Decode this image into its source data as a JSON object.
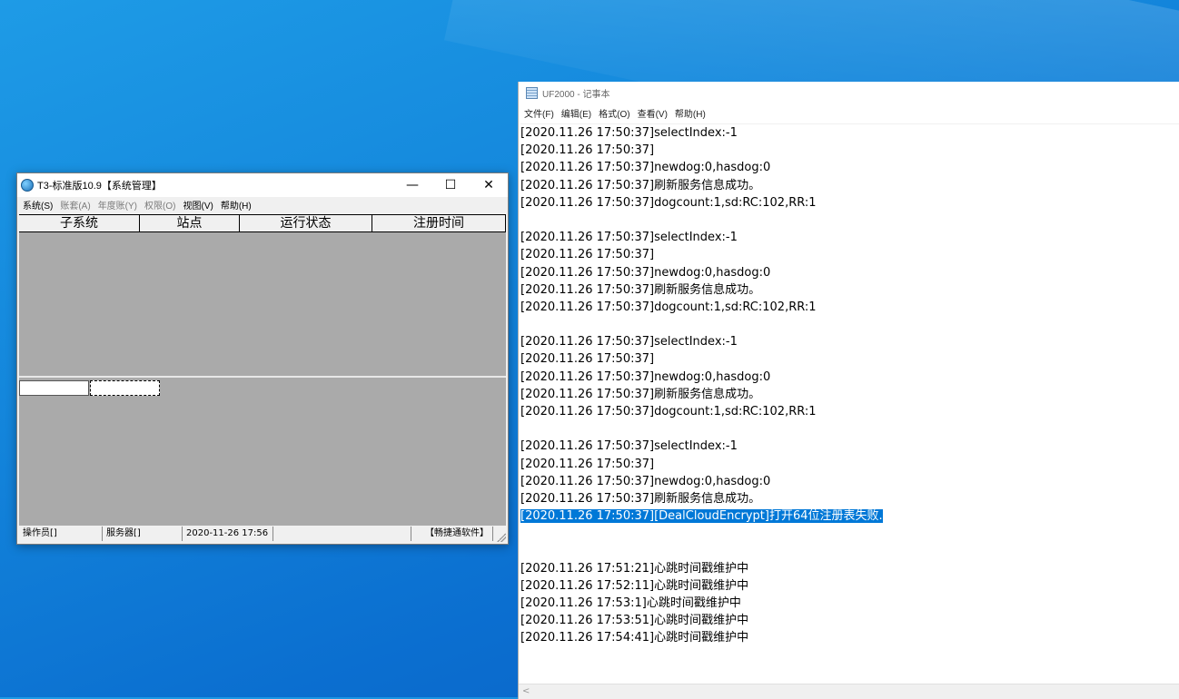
{
  "t3": {
    "title": "T3-标准版10.9【系统管理】",
    "controls": {
      "minimize": "—",
      "maximize": "☐",
      "close": "✕"
    },
    "menu": [
      {
        "label": "系统(S)",
        "enabled": true
      },
      {
        "label": "账套(A)",
        "enabled": false
      },
      {
        "label": "年度账(Y)",
        "enabled": false
      },
      {
        "label": "权限(O)",
        "enabled": false
      },
      {
        "label": "视图(V)",
        "enabled": true
      },
      {
        "label": "帮助(H)",
        "enabled": true
      }
    ],
    "columns": [
      "子系统",
      "站点",
      "运行状态",
      "注册时间"
    ],
    "status": {
      "operator": "操作员[]",
      "server": "服务器[]",
      "datetime": "2020-11-26 17:56",
      "empty": "",
      "brand": "【畅捷通软件】"
    }
  },
  "notepad": {
    "title": "UF2000 - 记事本",
    "menu": [
      "文件(F)",
      "编辑(E)",
      "格式(O)",
      "查看(V)",
      "帮助(H)"
    ],
    "lines": [
      "[2020.11.26 17:50:37]selectIndex:-1",
      "[2020.11.26 17:50:37]",
      "[2020.11.26 17:50:37]newdog:0,hasdog:0",
      "[2020.11.26 17:50:37]刷新服务信息成功。",
      "[2020.11.26 17:50:37]dogcount:1,sd:RC:102,RR:1",
      "",
      "[2020.11.26 17:50:37]selectIndex:-1",
      "[2020.11.26 17:50:37]",
      "[2020.11.26 17:50:37]newdog:0,hasdog:0",
      "[2020.11.26 17:50:37]刷新服务信息成功。",
      "[2020.11.26 17:50:37]dogcount:1,sd:RC:102,RR:1",
      "",
      "[2020.11.26 17:50:37]selectIndex:-1",
      "[2020.11.26 17:50:37]",
      "[2020.11.26 17:50:37]newdog:0,hasdog:0",
      "[2020.11.26 17:50:37]刷新服务信息成功。",
      "[2020.11.26 17:50:37]dogcount:1,sd:RC:102,RR:1",
      "",
      "[2020.11.26 17:50:37]selectIndex:-1",
      "[2020.11.26 17:50:37]",
      "[2020.11.26 17:50:37]newdog:0,hasdog:0",
      "[2020.11.26 17:50:37]刷新服务信息成功。",
      "[2020.11.26 17:50:37][DealCloudEncrypt]打开64位注册表失败.",
      "",
      "",
      "[2020.11.26 17:51:21]心跳时间戳维护中",
      "[2020.11.26 17:52:11]心跳时间戳维护中",
      "[2020.11.26 17:53:1]心跳时间戳维护中",
      "[2020.11.26 17:53:51]心跳时间戳维护中",
      "[2020.11.26 17:54:41]心跳时间戳维护中"
    ],
    "selected_line": 22,
    "scroll_left_arrow": "<"
  }
}
